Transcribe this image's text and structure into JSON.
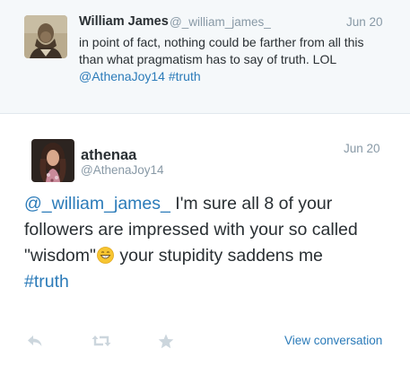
{
  "reply_context": {
    "name": "William James",
    "handle": "@_william_james_",
    "time": "Jun 20",
    "text_line1": "in point of fact, nothing could be farther from all this",
    "text_line2": "than what pragmatism has to say of truth. LOL",
    "mention": "@AthenaJoy14",
    "hashtag": "#truth"
  },
  "tweet": {
    "name": "athenaa",
    "handle": "@AthenaJoy14",
    "time": "Jun 20",
    "mention": "@_william_james_",
    "text_line1_rest": " I'm sure all 8 of your",
    "text_line2": "followers are impressed with your so called",
    "text_line3_pre": "\"wisdom\"",
    "text_line3_post": " your stupidity saddens me",
    "hashtag": "#truth",
    "emoji": "grinning-face-emoji"
  },
  "actions": {
    "reply_icon": "reply-icon",
    "retweet_icon": "retweet-icon",
    "favorite_icon": "star-icon",
    "view_conversation": "View conversation"
  },
  "colors": {
    "link": "#2b7bb9",
    "muted": "#8899a6",
    "text": "#292f33",
    "context_bg": "#f5f8fa"
  }
}
